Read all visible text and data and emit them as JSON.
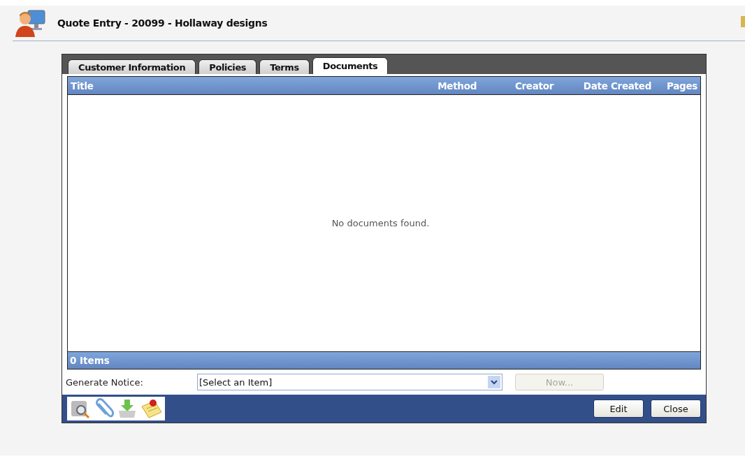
{
  "window": {
    "title": "Quote Entry - 20099 - Hollaway designs"
  },
  "tabs": [
    {
      "label": "Customer Information",
      "selected": false
    },
    {
      "label": "Policies",
      "selected": false
    },
    {
      "label": "Terms",
      "selected": false
    },
    {
      "label": "Documents",
      "selected": true
    }
  ],
  "table": {
    "columns": [
      "Title",
      "Method",
      "Creator",
      "Date Created",
      "Pages"
    ],
    "empty_message": "No documents found.",
    "footer": "0 Items"
  },
  "generate_notice": {
    "label": "Generate Notice:",
    "value": "[Select an Item]",
    "button": {
      "label": "Now...",
      "disabled": true
    }
  },
  "buttons": [
    "Edit",
    "Close"
  ]
}
